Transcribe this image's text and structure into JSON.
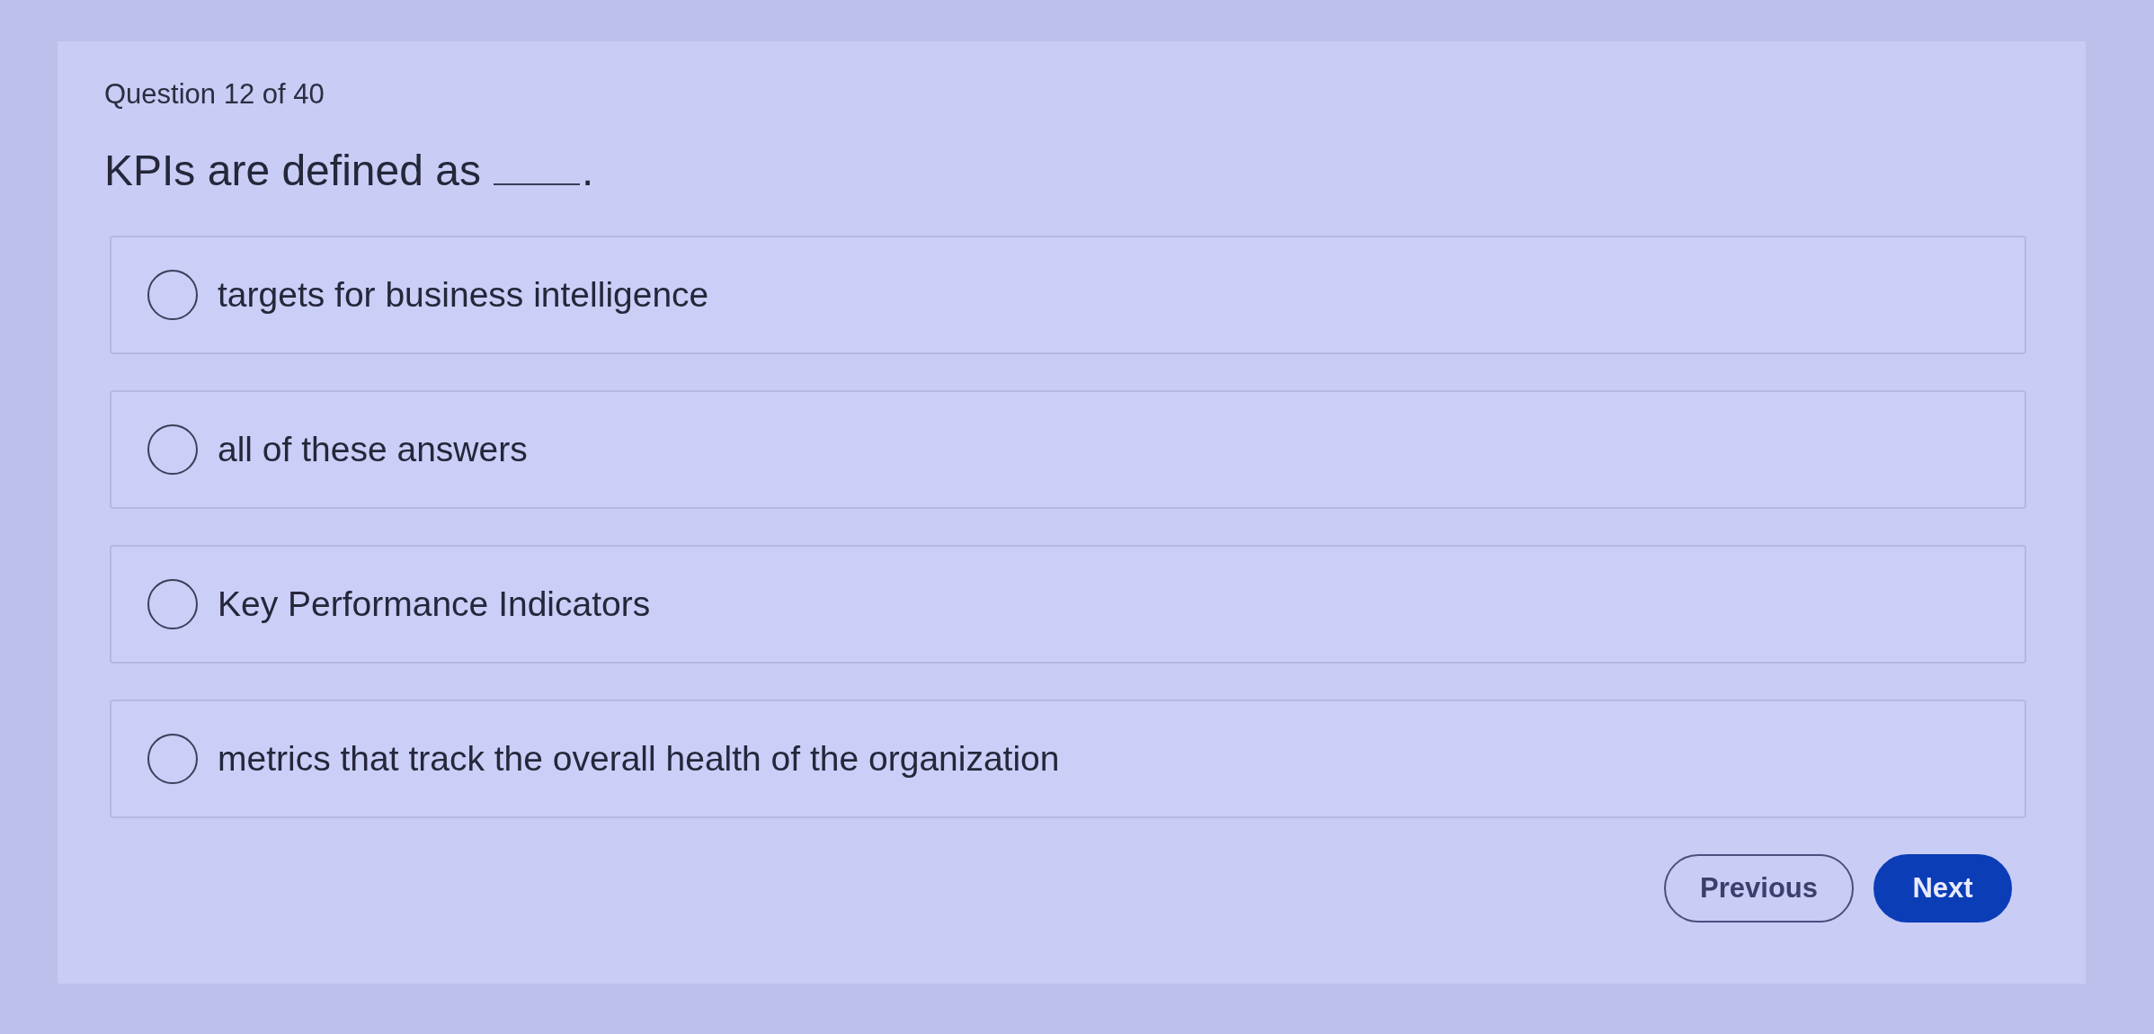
{
  "progress": {
    "text": "Question 12 of 40"
  },
  "question": {
    "text": "KPIs are defined as",
    "after_blank": "."
  },
  "options": [
    {
      "text": "targets for business intelligence",
      "selected": false
    },
    {
      "text": "all of these answers",
      "selected": false
    },
    {
      "text": "Key Performance Indicators",
      "selected": false
    },
    {
      "text": "metrics that track the overall health of the organization",
      "selected": false
    }
  ],
  "buttons": [
    {
      "label": "Previous",
      "kind": "outline"
    },
    {
      "label": "Next",
      "kind": "primary"
    }
  ]
}
